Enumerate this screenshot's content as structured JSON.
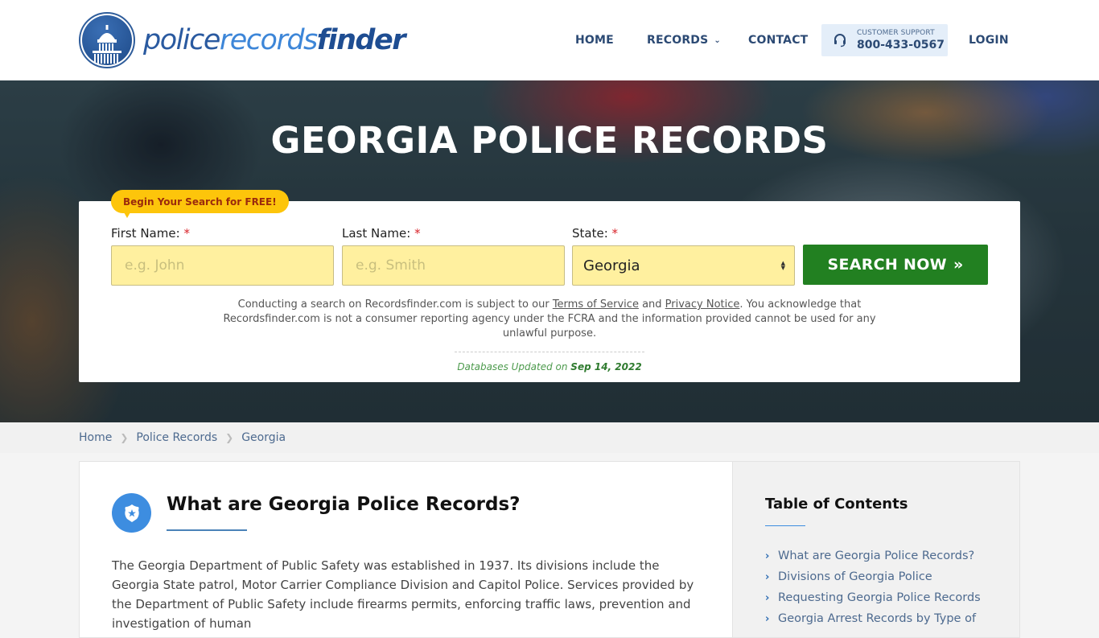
{
  "brand": {
    "name_part1": "police",
    "name_part2": "records",
    "name_part3": "finder"
  },
  "nav": {
    "home": "HOME",
    "records": "RECORDS",
    "contact": "CONTACT",
    "support_label": "CUSTOMER SUPPORT",
    "support_phone": "800-433-0567",
    "login": "LOGIN"
  },
  "hero": {
    "title": "GEORGIA POLICE RECORDS",
    "badge": "Begin Your Search for FREE!",
    "first_name_label": "First Name:",
    "last_name_label": "Last Name:",
    "state_label": "State:",
    "required_mark": "*",
    "first_name_placeholder": "e.g. John",
    "first_name_value": "",
    "last_name_placeholder": "e.g. Smith",
    "last_name_value": "",
    "state_value": "Georgia",
    "search_button": "SEARCH NOW",
    "search_button_icon": "»",
    "disclaimer_part1": "Conducting a search on Recordsfinder.com is subject to our ",
    "terms_link": "Terms of Service",
    "disclaimer_and": " and ",
    "privacy_link": "Privacy Notice",
    "disclaimer_part2": ". You acknowledge that Recordsfinder.com is not a consumer reporting agency under the FCRA and the information provided cannot be used for any unlawful purpose.",
    "updated_label": "Databases Updated on ",
    "updated_date": "Sep 14, 2022"
  },
  "breadcrumb": [
    {
      "label": "Home"
    },
    {
      "label": "Police Records"
    },
    {
      "label": "Georgia"
    }
  ],
  "article": {
    "title": "What are Georgia Police Records?",
    "body": "The Georgia Department of Public Safety was established in 1937. Its divisions include the Georgia State patrol, Motor Carrier Compliance Division and Capitol Police. Services provided by the Department of Public Safety include firearms permits, enforcing traffic laws, prevention and investigation of human"
  },
  "toc": {
    "title": "Table of Contents",
    "items": [
      {
        "label": "What are Georgia Police Records?"
      },
      {
        "label": "Divisions of Georgia Police"
      },
      {
        "label": "Requesting Georgia Police Records"
      },
      {
        "label": "Georgia Arrest Records by Type of"
      }
    ]
  },
  "colors": {
    "brand_blue": "#2a5aa0",
    "search_green": "#228021",
    "input_yellow": "#fff09f",
    "badge_yellow": "#fdc50b",
    "link_blue": "#4d6a8f"
  }
}
